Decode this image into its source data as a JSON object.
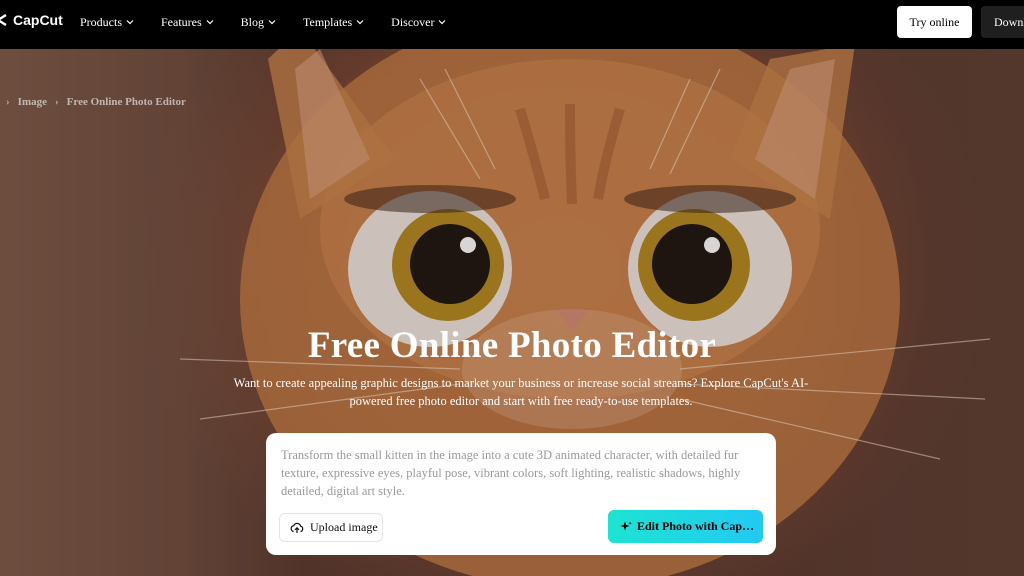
{
  "nav": {
    "logo_text": "CapCut",
    "items": [
      {
        "label": "Products"
      },
      {
        "label": "Features"
      },
      {
        "label": "Blog"
      },
      {
        "label": "Templates"
      },
      {
        "label": "Discover"
      }
    ],
    "try_online_label": "Try online",
    "download_label": "Downl"
  },
  "breadcrumb": {
    "items": [
      "Image",
      "Free Online Photo Editor"
    ]
  },
  "hero": {
    "title": "Free Online Photo Editor",
    "subtitle": "Want to create appealing graphic designs to market your business or increase social streams? Explore CapCut's AI-powered free photo editor and start with free ready-to-use templates."
  },
  "prompt_card": {
    "prompt_text": "Transform the small kitten in the image into a cute 3D animated character, with detailed fur texture, expressive eyes, playful pose, vibrant colors, soft lighting, realistic shadows, highly detailed, digital art style.",
    "upload_label": "Upload image",
    "edit_label": "Edit Photo with Cap…"
  },
  "icons": {
    "logo": "capcut-logo-icon",
    "chevron": "chevron-down-icon",
    "upload": "cloud-upload-icon",
    "sparkle": "sparkle-icon"
  },
  "colors": {
    "nav_bg": "#000000",
    "edit_button_gradient_start": "#1ee3d2",
    "edit_button_gradient_end": "#22c9f3"
  }
}
